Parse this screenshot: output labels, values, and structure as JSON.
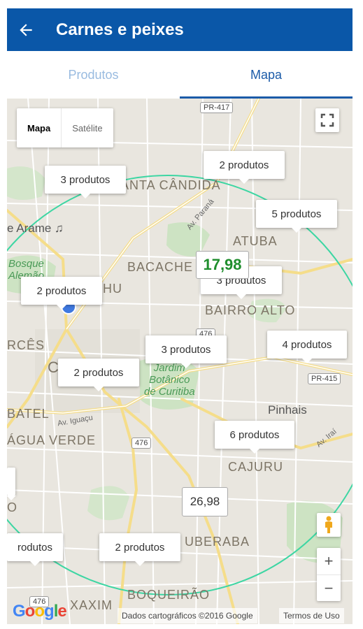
{
  "header": {
    "back_icon": "arrow-left-icon",
    "title": "Carnes e peixes",
    "bg_color": "#0a57a8"
  },
  "tabs": [
    {
      "label": "Produtos",
      "active": false
    },
    {
      "label": "Mapa",
      "active": true
    }
  ],
  "map": {
    "map_type": {
      "map": "Mapa",
      "satellite": "Satélite"
    },
    "fullscreen_icon": "fullscreen-icon",
    "area_labels": {
      "santa_candida": "ANTA CÂNDIDA",
      "atuba": "ATUBA",
      "bacacheri": "BACACHE",
      "bairro_alto": "BAIRRO ALTO",
      "hu": "HU",
      "merces": "RCÊS",
      "batel": "BATEL",
      "agua_verde": "ÁGUA VERDE",
      "cajuru": "CAJURU",
      "uberaba": "UBERABA",
      "boqueirao": "BOQUEIRÃO",
      "xaxim": "XAXIM",
      "o": "O",
      "c": "C"
    },
    "place_labels": {
      "arame": "e Arame ♫",
      "bosque": "Bosque\nAlemão",
      "jardim": "Jardim\nBotânico\nde Curitiba",
      "pinhais": "Pinhais"
    },
    "road_labels": {
      "av_parana": "Av. Paraná",
      "av_iguacu": "Av. Iguaçu",
      "av_iraí": "Av. Iraí"
    },
    "shields": {
      "pr417": "PR-417",
      "pr415": "PR-415",
      "br476a": "476",
      "br476b": "476",
      "br476c": "476"
    },
    "markers": [
      {
        "label": "3 produtos"
      },
      {
        "label": "2 produtos"
      },
      {
        "label": "5 produtos"
      },
      {
        "label": "3 produtos"
      },
      {
        "label": "2 produtos"
      },
      {
        "label": "3 produtos"
      },
      {
        "label": "4 produtos"
      },
      {
        "label": "2 produtos"
      },
      {
        "label": "6 produtos"
      },
      {
        "label": "rodutos"
      },
      {
        "label": "2 produtos"
      }
    ],
    "prices": [
      {
        "value": "17,98",
        "color": "#1f8e2d"
      },
      {
        "value": "26,98",
        "color": "#333333"
      }
    ],
    "pegman_icon": "pegman-icon",
    "zoom": {
      "in": "+",
      "out": "−"
    },
    "logo": "Google",
    "attribution": "Dados cartográficos ©2016 Google",
    "terms": "Termos de Uso",
    "radius_color": "#3dd6a3"
  }
}
